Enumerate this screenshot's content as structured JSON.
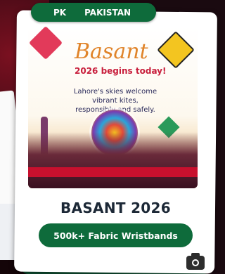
{
  "country": {
    "code": "PK",
    "name": "PAKISTAN"
  },
  "poster": {
    "title": "Basant",
    "subtitle": "2026 begins today!",
    "message": "Lahore's skies welcome vibrant kites, responsibly and safely."
  },
  "event": {
    "title": "BASANT 2026"
  },
  "wristbands": {
    "label": "500k+ Fabric Wristbands"
  },
  "colors": {
    "accent": "#0e6b3b",
    "title": "#1c2836"
  },
  "icons": {
    "camera": "camera-icon"
  }
}
